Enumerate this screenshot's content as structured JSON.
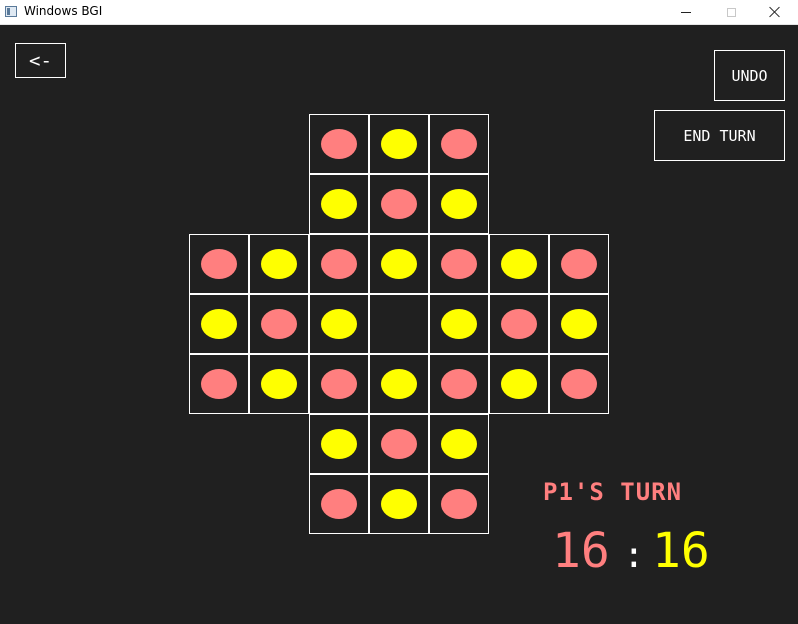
{
  "window": {
    "title": "Windows BGI"
  },
  "buttons": {
    "back_label": "<-",
    "undo_label": "UNDO",
    "end_turn_label": "END TURN"
  },
  "colors": {
    "background": "#202020",
    "p1": "#ff7f7f",
    "p2": "#ffff00",
    "grid": "#ffffff"
  },
  "board": {
    "rows": [
      [
        null,
        null,
        "P",
        "Y",
        "P",
        null,
        null
      ],
      [
        null,
        null,
        "Y",
        "P",
        "Y",
        null,
        null
      ],
      [
        "P",
        "Y",
        "P",
        "Y",
        "P",
        "Y",
        "P"
      ],
      [
        "Y",
        "P",
        "Y",
        "",
        "Y",
        "P",
        "Y"
      ],
      [
        "P",
        "Y",
        "P",
        "Y",
        "P",
        "Y",
        "P"
      ],
      [
        null,
        null,
        "Y",
        "P",
        "Y",
        null,
        null
      ],
      [
        null,
        null,
        "P",
        "Y",
        "P",
        null,
        null
      ]
    ]
  },
  "status": {
    "turn_text": "P1'S TURN",
    "score_p1": "16",
    "separator": ":",
    "score_p2": "16"
  }
}
